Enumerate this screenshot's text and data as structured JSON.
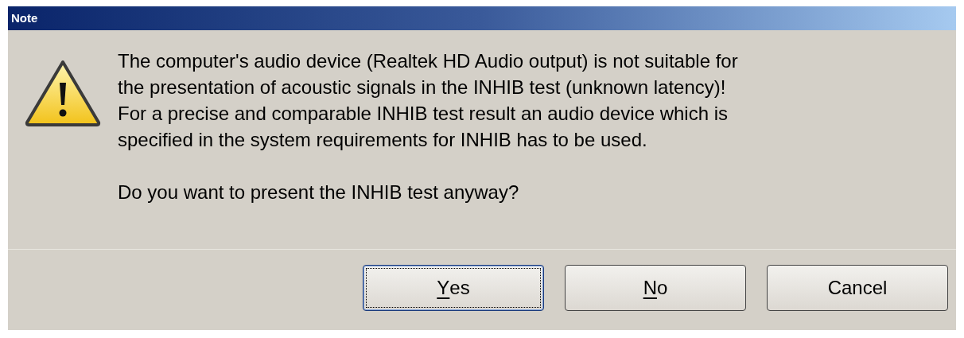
{
  "window": {
    "title": "Note"
  },
  "message": {
    "lines": [
      "The computer's audio device (Realtek HD Audio output) is not suitable for",
      "the presentation of acoustic signals in the INHIB test (unknown latency)!",
      "For a precise and comparable INHIB test result an audio device which is",
      "specified in the system requirements for INHIB has to be used."
    ],
    "question": "Do you want to present the INHIB test anyway?"
  },
  "buttons": [
    {
      "mnemonic": "Y",
      "rest": "es",
      "focused": true
    },
    {
      "mnemonic": "N",
      "rest": "o",
      "focused": false
    },
    {
      "rest": "Cancel",
      "focused": false
    }
  ]
}
